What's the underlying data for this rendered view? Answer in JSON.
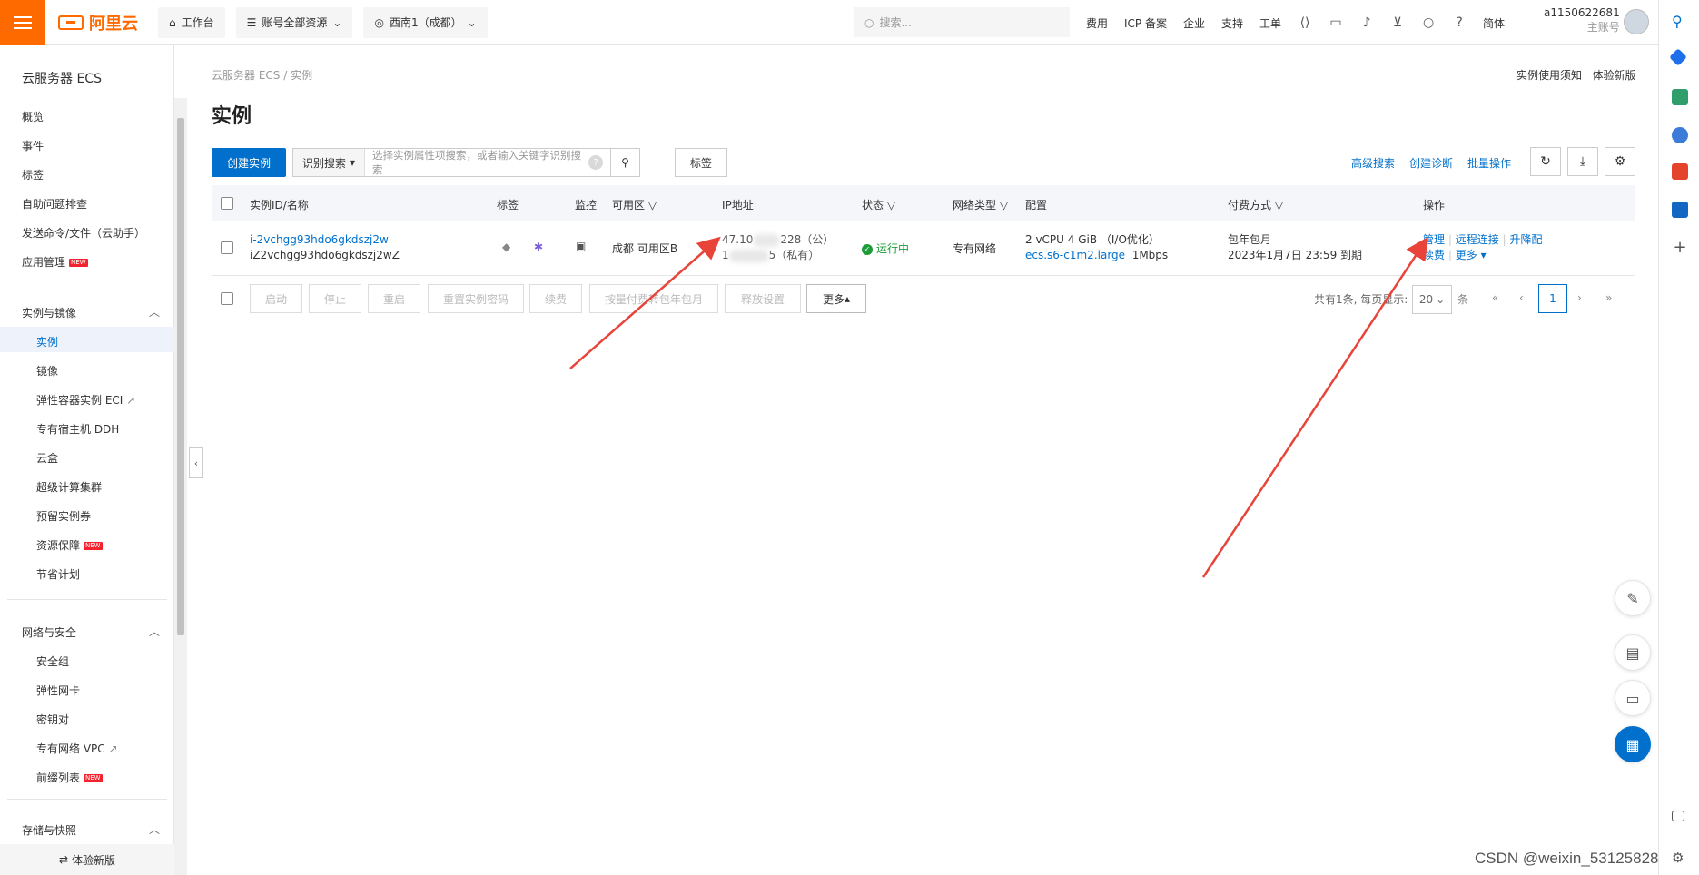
{
  "topbar": {
    "logo_text": "阿里云",
    "workbench": "工作台",
    "resources": "账号全部资源",
    "region": "西南1（成都）",
    "search_placeholder": "搜索...",
    "links": [
      "费用",
      "ICP 备案",
      "企业",
      "支持",
      "工单"
    ],
    "lang": "简体",
    "user_id": "a1150622681",
    "user_role": "主账号"
  },
  "sidebar": {
    "title": "云服务器 ECS",
    "top_items": [
      "概览",
      "事件",
      "标签",
      "自助问题排查",
      "发送命令/文件（云助手）",
      "应用管理"
    ],
    "group1": {
      "label": "实例与镜像",
      "items": [
        "实例",
        "镜像",
        "弹性容器实例 ECI",
        "专有宿主机 DDH",
        "云盒",
        "超级计算集群",
        "预留实例券",
        "资源保障",
        "节省计划"
      ]
    },
    "group2": {
      "label": "网络与安全",
      "items": [
        "安全组",
        "弹性网卡",
        "密钥对",
        "专有网络 VPC",
        "前缀列表"
      ]
    },
    "group3": {
      "label": "存储与快照"
    },
    "new_badge": "NEW",
    "bottom": "体验新版"
  },
  "main": {
    "breadcrumb": [
      "云服务器 ECS",
      "实例"
    ],
    "top_links": [
      "实例使用须知",
      "体验新版"
    ],
    "title": "实例",
    "create_btn": "创建实例",
    "filter_select": "识别搜索",
    "filter_placeholder": "选择实例属性项搜索，或者输入关键字识别搜索",
    "tag_btn": "标签",
    "action_links": [
      "高级搜索",
      "创建诊断",
      "批量操作"
    ],
    "columns": [
      "实例ID/名称",
      "标签",
      "监控",
      "可用区",
      "IP地址",
      "状态",
      "网络类型",
      "配置",
      "付费方式",
      "操作"
    ],
    "rows": [
      {
        "id": "i-2vchgg93hdo6gkdszj2w",
        "name": "iZ2vchgg93hdo6gkdszj2wZ",
        "zone": "成都 可用区B",
        "ip_public_a": "47.10",
        "ip_public_b": "228（公）",
        "ip_private_a": "1",
        "ip_private_b": "5（私有）",
        "status": "运行中",
        "network": "专有网络",
        "config_line1": "2 vCPU 4 GiB （I/O优化）",
        "config_type": "ecs.s6-c1m2.large",
        "config_bw": "1Mbps",
        "pay_line1": "包年包月",
        "pay_line2": "2023年1月7日 23:59 到期",
        "ops": [
          "管理",
          "远程连接",
          "升降配",
          "续费",
          "更多"
        ]
      }
    ],
    "bulk_buttons": [
      "启动",
      "停止",
      "重启",
      "重置实例密码",
      "续费",
      "按量付费转包年包月",
      "释放设置",
      "更多"
    ],
    "pager_text": "共有1条, 每页显示:",
    "page_size": "20",
    "page_unit": "条",
    "current_page": "1"
  },
  "watermark": "CSDN @weixin_53125828"
}
